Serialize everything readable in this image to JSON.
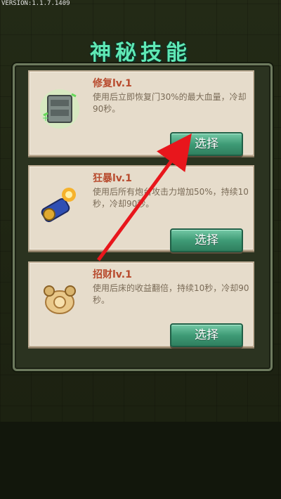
{
  "version": "VERSION:1.1.7.1409",
  "title": "神秘技能",
  "skills": [
    {
      "name": "修复lv.1",
      "desc": "使用后立即恢复门30%的最大血量，冷却90秒。",
      "button": "选择",
      "icon": "repair-door-icon"
    },
    {
      "name": "狂暴lv.1",
      "desc": "使用后所有炮台攻击力增加50%，持续10秒，冷却90秒。",
      "button": "选择",
      "icon": "rage-cannon-icon"
    },
    {
      "name": "招财lv.1",
      "desc": "使用后床的收益翻倍，持续10秒，冷却90秒。",
      "button": "选择",
      "icon": "fortune-coins-icon"
    }
  ],
  "colors": {
    "title": "#5fe8b5",
    "button": "#3f9b76",
    "arrow": "#e8161c"
  }
}
